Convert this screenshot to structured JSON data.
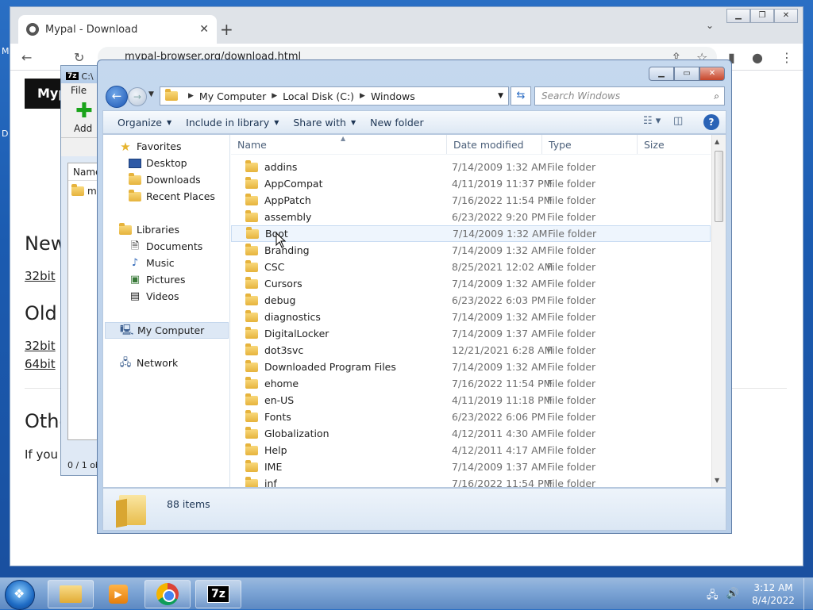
{
  "desktop": {
    "edge_m": "M",
    "edge_d": "D"
  },
  "browser": {
    "tab_title": "Mypal - Download",
    "new_tab": "+",
    "url": "mypal-browser.org/download.html",
    "page": {
      "logo": "Myp",
      "heading_new": "New",
      "link_new_32": "32bit",
      "heading_old": "Old",
      "link_old_32": "32bit",
      "link_old_64": "64bit",
      "heading_other": "Othe",
      "text_other": "If you"
    }
  },
  "sevenzip": {
    "title": "C:\\",
    "logo": "7z",
    "menu_file": "File",
    "add_label": "Add",
    "col_name": "Name",
    "row_name": "my",
    "status": "0 / 1 ob"
  },
  "explorer": {
    "address": {
      "crumbs": [
        "My Computer",
        "Local Disk (C:)",
        "Windows"
      ]
    },
    "search_placeholder": "Search Windows",
    "commands": {
      "organize": "Organize",
      "include": "Include in library",
      "share": "Share with",
      "new_folder": "New folder"
    },
    "nav": {
      "favorites": "Favorites",
      "desktop": "Desktop",
      "downloads": "Downloads",
      "recent": "Recent Places",
      "libraries": "Libraries",
      "documents": "Documents",
      "music": "Music",
      "pictures": "Pictures",
      "videos": "Videos",
      "my_computer": "My Computer",
      "network": "Network"
    },
    "columns": {
      "name": "Name",
      "date": "Date modified",
      "type": "Type",
      "size": "Size"
    },
    "files": [
      {
        "name": "addins",
        "date": "7/14/2009 1:32 AM",
        "type": "File folder"
      },
      {
        "name": "AppCompat",
        "date": "4/11/2019 11:37 PM",
        "type": "File folder"
      },
      {
        "name": "AppPatch",
        "date": "7/16/2022 11:54 PM",
        "type": "File folder"
      },
      {
        "name": "assembly",
        "date": "6/23/2022 9:20 PM",
        "type": "File folder"
      },
      {
        "name": "Boot",
        "date": "7/14/2009 1:32 AM",
        "type": "File folder"
      },
      {
        "name": "Branding",
        "date": "7/14/2009 1:32 AM",
        "type": "File folder"
      },
      {
        "name": "CSC",
        "date": "8/25/2021 12:02 AM",
        "type": "File folder"
      },
      {
        "name": "Cursors",
        "date": "7/14/2009 1:32 AM",
        "type": "File folder"
      },
      {
        "name": "debug",
        "date": "6/23/2022 6:03 PM",
        "type": "File folder"
      },
      {
        "name": "diagnostics",
        "date": "7/14/2009 1:32 AM",
        "type": "File folder"
      },
      {
        "name": "DigitalLocker",
        "date": "7/14/2009 1:37 AM",
        "type": "File folder"
      },
      {
        "name": "dot3svc",
        "date": "12/21/2021 6:28 AM",
        "type": "File folder"
      },
      {
        "name": "Downloaded Program Files",
        "date": "7/14/2009 1:32 AM",
        "type": "File folder"
      },
      {
        "name": "ehome",
        "date": "7/16/2022 11:54 PM",
        "type": "File folder"
      },
      {
        "name": "en-US",
        "date": "4/11/2019 11:18 PM",
        "type": "File folder"
      },
      {
        "name": "Fonts",
        "date": "6/23/2022 6:06 PM",
        "type": "File folder"
      },
      {
        "name": "Globalization",
        "date": "4/12/2011 4:30 AM",
        "type": "File folder"
      },
      {
        "name": "Help",
        "date": "4/12/2011 4:17 AM",
        "type": "File folder"
      },
      {
        "name": "IME",
        "date": "7/14/2009 1:37 AM",
        "type": "File folder"
      },
      {
        "name": "inf",
        "date": "7/16/2022 11:54 PM",
        "type": "File folder"
      }
    ],
    "items_count": "88 items"
  },
  "taskbar": {
    "seven_zip": "7z",
    "time": "3:12 AM",
    "date": "8/4/2022"
  }
}
